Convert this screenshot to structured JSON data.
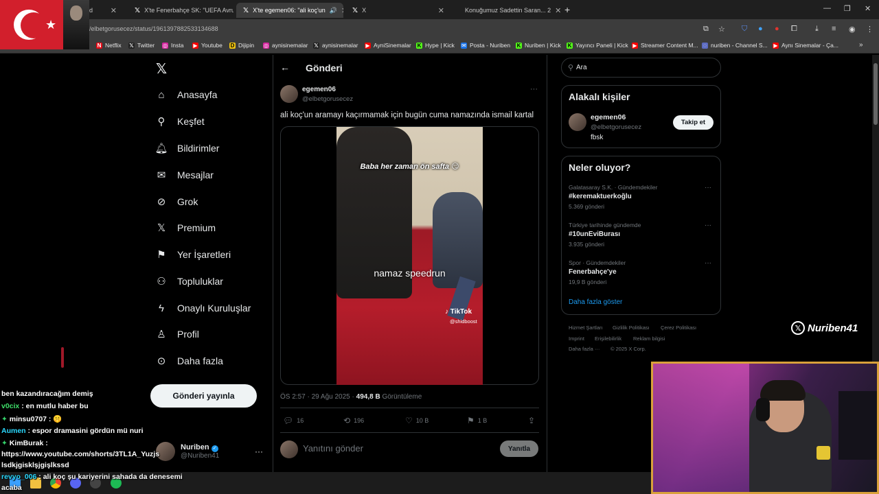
{
  "browser": {
    "tabs": [
      {
        "label": "d"
      },
      {
        "label": "X'te Fenerbahçe SK: \"UEFA Avru"
      },
      {
        "label": "X'te egemen06: \"ali koç'un"
      },
      {
        "label": "X"
      },
      {
        "label": "Konuğumuz Sadettin Saran... 2"
      }
    ],
    "url": "/elbetgorusecez/status/1961397882533134688",
    "bookmarks": [
      "Netflix",
      "Twitter",
      "Insta",
      "Youtube",
      "Dijipin",
      "aynisinemalar",
      "aynisinemalar",
      "AyniSinemalar",
      "Hype | Kick",
      "Posta - Nuriben",
      "Nuriben | Kick",
      "Yayıncı Paneli | Kick",
      "Streamer Content M...",
      "nuriben - Channel S...",
      "Aynı Sinemalar - Ça..."
    ]
  },
  "nav": {
    "items": [
      "Anasayfa",
      "Keşfet",
      "Bildirimler",
      "Mesajlar",
      "Grok",
      "Premium",
      "Yer İşaretleri",
      "Topluluklar",
      "Onaylı Kuruluşlar",
      "Profil",
      "Daha fazla"
    ],
    "post_button": "Gönderi yayınla",
    "account_name": "Nuriben",
    "account_handle": "@Nuriben41"
  },
  "post": {
    "header": "Gönderi",
    "author_name": "egemen06",
    "author_handle": "@elbetgorusecez",
    "text": "ali koç'un aramayı kaçırmamak için bugün cuma namazında ismail kartal",
    "caption_top": "Baba her zaman ön safta 😏",
    "caption_center": "namaz speedrun",
    "tiktok_label": "TikTok",
    "tiktok_user": "@shidboost",
    "time": "ÖS 2:57 · 29 Ağu 2025 · ",
    "views": "494,8 B",
    "views_label": " Görüntüleme",
    "replies": "16",
    "reposts": "196",
    "likes": "10 B",
    "bookmarks": "1 B",
    "reply_placeholder": "Yanıtını gönder",
    "reply_button": "Yanıtla"
  },
  "sidebar": {
    "search_placeholder": "Ara",
    "related_title": "Alakalı kişiler",
    "related_name": "egemen06",
    "related_handle": "@elbetgorusecez",
    "related_bio": "fbsk",
    "follow_label": "Takip et",
    "trends_title": "Neler oluyor?",
    "trends": [
      {
        "context": "Galatasaray S.K. · Gündemdekiler",
        "name": "#keremaktuerkoğlu",
        "count": "5.369 gönderi"
      },
      {
        "context": "Türkiye tarihinde gündemde",
        "name": "#10unEviBurası",
        "count": "3.935 gönderi"
      },
      {
        "context": "Spor · Gündemdekiler",
        "name": "Fenerbahçe'ye",
        "count": "19,9 B gönderi"
      }
    ],
    "show_more": "Daha fazla göster",
    "footer": [
      "Hizmet Şartları",
      "Gizlilik Politikası",
      "Çerez Politikası",
      "Imprint",
      "Erişilebilirlik",
      "Reklam bilgisi",
      "Daha fazla ···",
      "© 2025 X Corp."
    ]
  },
  "watermark": "Nuriben41",
  "chat": [
    {
      "user": "",
      "msg": "ben kazandıracağım demiş"
    },
    {
      "user": "v0cix",
      "msg": " : en mutlu haber bu"
    },
    {
      "user": "minsu0707",
      "msg": " : 🤫"
    },
    {
      "user": "Aumen",
      "msg": " : espor dramasini gördün mü nuri"
    },
    {
      "user": "KimBurak",
      "msg": " :"
    },
    {
      "user": "",
      "msg": "https://www.youtube.com/shorts/3TL1A_Yuzjs"
    },
    {
      "user": "",
      "msg": "lsdkjgisklşjgişlkssd"
    },
    {
      "user": "revyo_006",
      "msg": " : ali koç şu kariyerini sahada da denesemi"
    },
    {
      "user": "",
      "msg": "acaba"
    }
  ]
}
